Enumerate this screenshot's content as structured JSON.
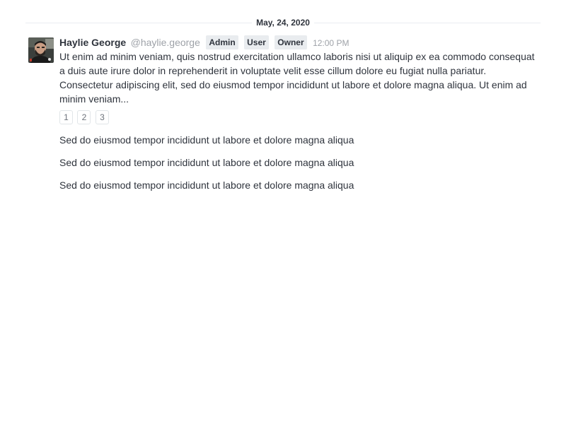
{
  "divider": {
    "date": "May, 24, 2020"
  },
  "message": {
    "avatar_icon": "user-avatar-photo",
    "author_name": "Haylie George",
    "username": "@haylie.george",
    "roles": [
      "Admin",
      "User",
      "Owner"
    ],
    "time": "12:00 PM",
    "body": "Ut enim ad minim veniam, quis nostrud exercitation ullamco laboris nisi ut aliquip ex ea commodo consequat a duis aute irure dolor in reprehenderit in voluptate velit esse cillum dolore eu fugiat nulla pariatur. Consectetur adipiscing elit, sed do eiusmod tempor incididunt ut labore et dolore magna aliqua. Ut enim ad minim veniam...",
    "pages": [
      "1",
      "2",
      "3"
    ]
  },
  "sequential": [
    "Sed do eiusmod tempor incididunt ut labore et dolore magna aliqua",
    "Sed do eiusmod tempor incididunt ut labore et dolore magna aliqua",
    "Sed do eiusmod tempor incididunt ut labore et dolore magna aliqua"
  ]
}
